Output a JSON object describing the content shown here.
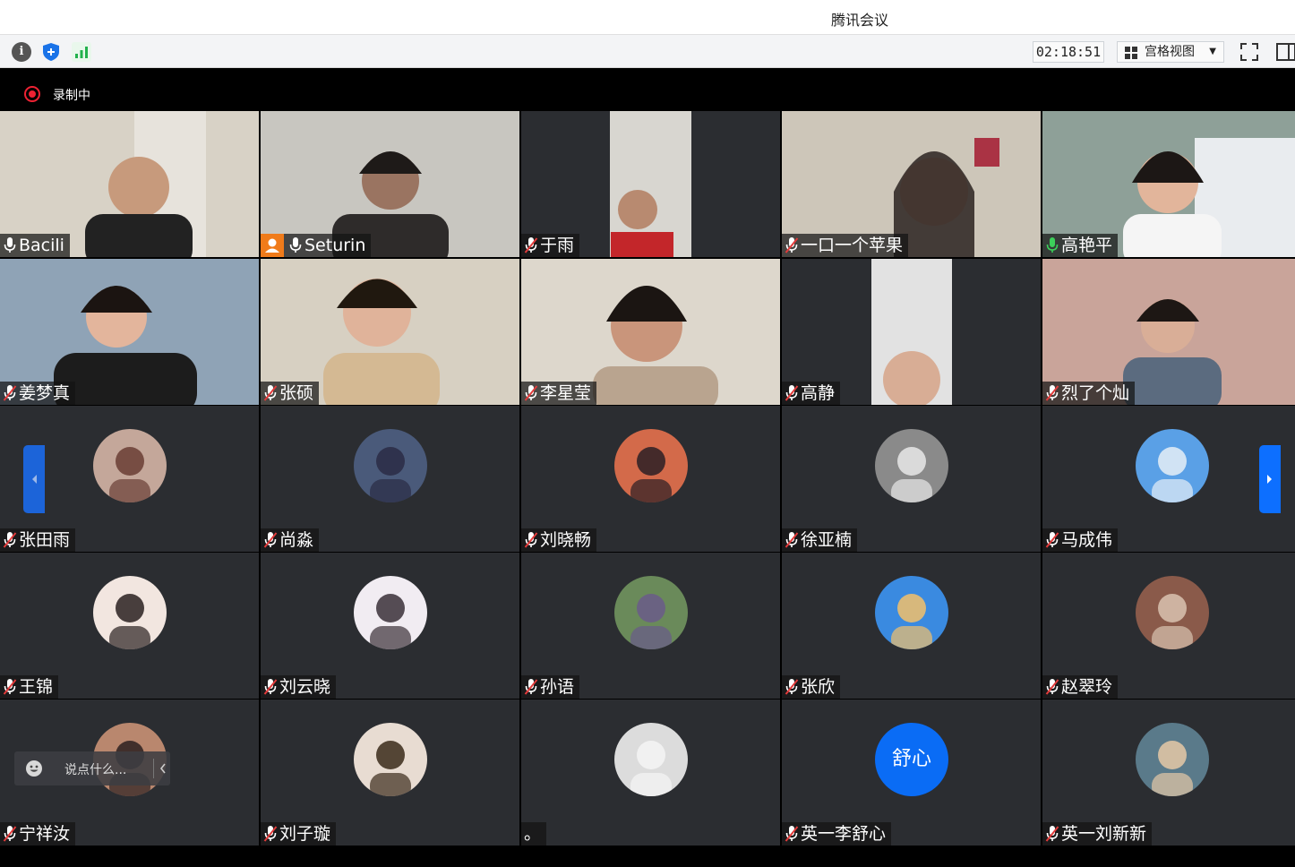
{
  "window": {
    "title": "腾讯会议"
  },
  "toolbar": {
    "timer": "02:18:51",
    "view_label": "宫格视图",
    "icons": [
      "info-icon",
      "shield-icon",
      "signal-icon",
      "grid-icon",
      "fullscreen-icon",
      "sidebar-icon"
    ]
  },
  "recording": {
    "label": "录制中",
    "color": "#e22233"
  },
  "chat": {
    "placeholder": "说点什么..."
  },
  "colors": {
    "accent": "#0d6fff",
    "host_badge": "#f07b1a",
    "tile_bg": "#2b2d31",
    "active_speaker": "#3ccf5a"
  },
  "participants": [
    {
      "name": "Bacili",
      "mic": "on",
      "video": true
    },
    {
      "name": "Seturin",
      "mic": "on",
      "video": true,
      "host": true
    },
    {
      "name": "于雨",
      "mic": "muted",
      "video": true
    },
    {
      "name": "一口一个苹果",
      "mic": "muted",
      "video": true
    },
    {
      "name": "高艳平",
      "mic": "active",
      "video": true
    },
    {
      "name": "姜梦真",
      "mic": "muted",
      "video": true
    },
    {
      "name": "张硕",
      "mic": "muted",
      "video": true
    },
    {
      "name": "李星莹",
      "mic": "muted",
      "video": true
    },
    {
      "name": "高静",
      "mic": "muted",
      "video": true
    },
    {
      "name": "烈了个灿",
      "mic": "muted",
      "video": true
    },
    {
      "name": "张田雨",
      "mic": "muted",
      "video": false
    },
    {
      "name": "尚淼",
      "mic": "muted",
      "video": false
    },
    {
      "name": "刘晓畅",
      "mic": "muted",
      "video": false
    },
    {
      "name": "徐亚楠",
      "mic": "muted",
      "video": false
    },
    {
      "name": "马成伟",
      "mic": "muted",
      "video": false
    },
    {
      "name": "王锦",
      "mic": "muted",
      "video": false
    },
    {
      "name": "刘云晓",
      "mic": "muted",
      "video": false
    },
    {
      "name": "孙语",
      "mic": "muted",
      "video": false
    },
    {
      "name": "张欣",
      "mic": "muted",
      "video": false
    },
    {
      "name": "赵翠玲",
      "mic": "muted",
      "video": false
    },
    {
      "name": "宁祥汝",
      "mic": "muted",
      "video": false
    },
    {
      "name": "刘子璇",
      "mic": "muted",
      "video": false
    },
    {
      "name": "。",
      "mic": "none",
      "video": false
    },
    {
      "name": "英一李舒心",
      "mic": "muted",
      "video": false,
      "avatar_text": "舒心"
    },
    {
      "name": "英一刘新新",
      "mic": "muted",
      "video": false
    }
  ]
}
